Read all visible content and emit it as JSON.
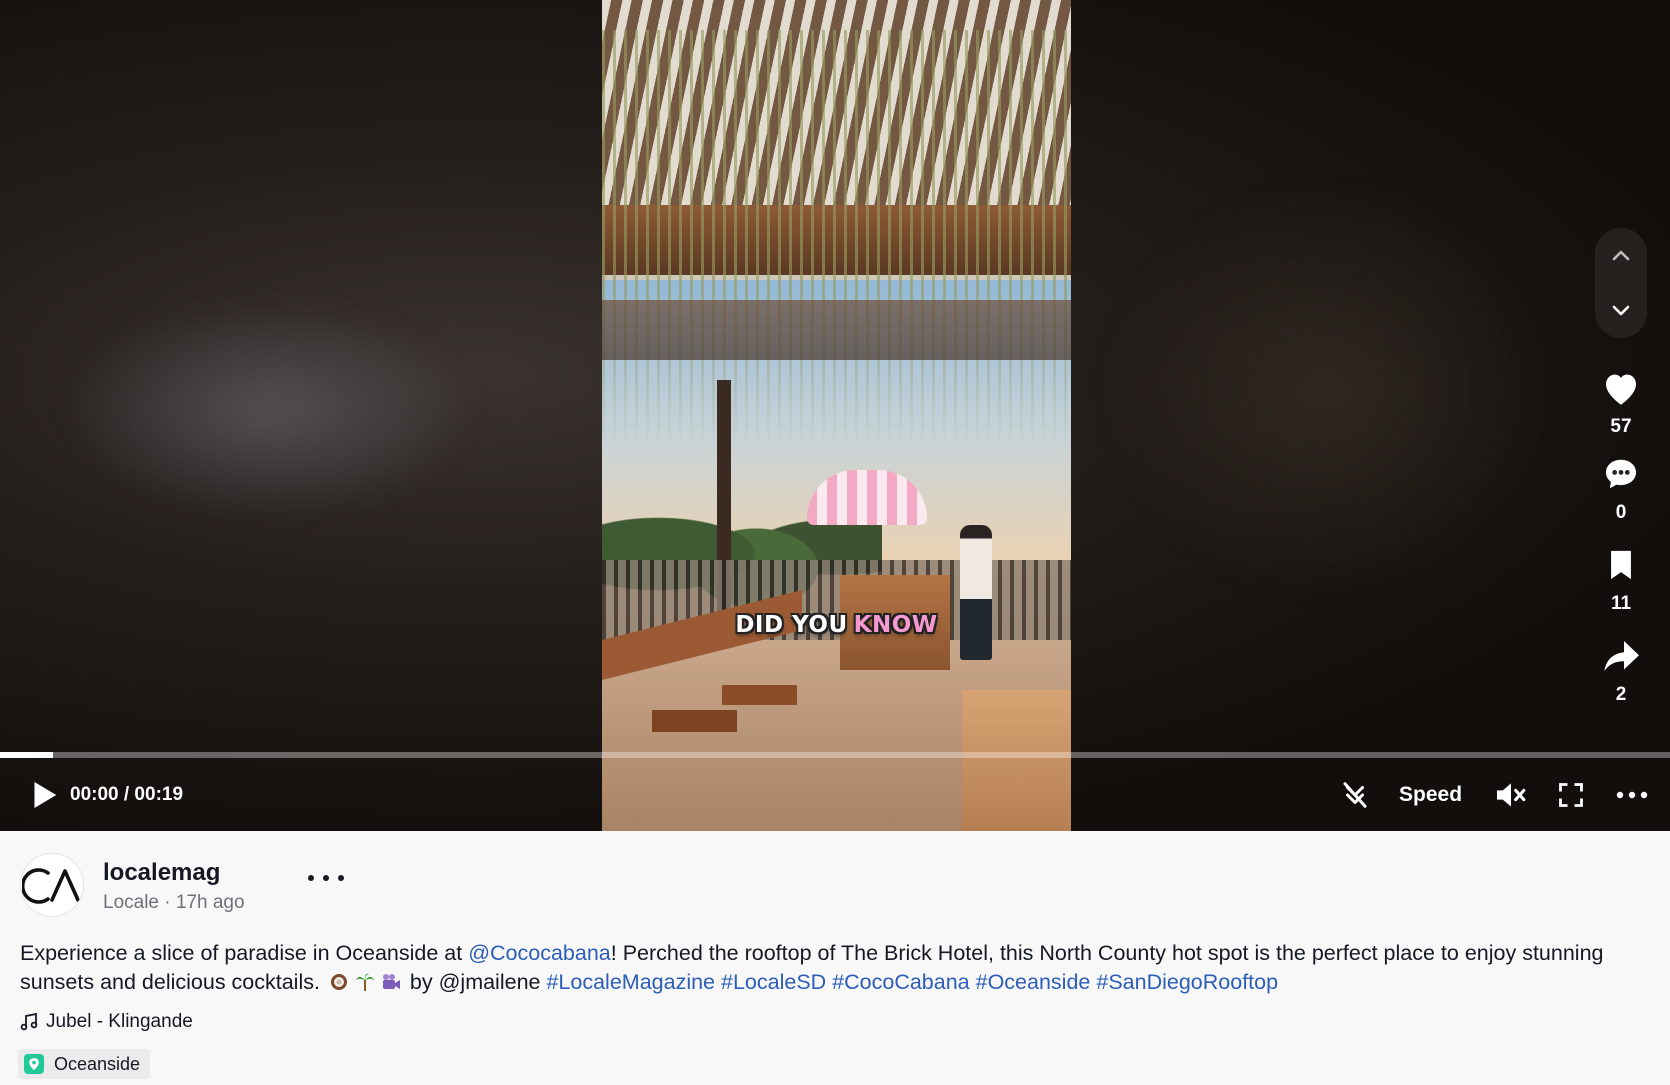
{
  "video": {
    "overlay_caption_part1": "DID YOU",
    "overlay_caption_part2": "KNOW",
    "current_time": "00:00",
    "duration": "00:19",
    "time_display": "00:00 / 00:19",
    "progress_fraction": 0.032
  },
  "actions": {
    "likes": "57",
    "comments": "0",
    "bookmarks": "11",
    "shares": "2"
  },
  "controls": {
    "speed_label": "Speed"
  },
  "post": {
    "username": "localemag",
    "display_name": "Locale",
    "time_ago": "17h ago",
    "subtitle": "Locale · 17h ago",
    "description": {
      "text_1": "Experience a slice of paradise in Oceanside at ",
      "mention": "@Cococabana",
      "text_2": "! Perched the rooftop of The Brick Hotel, this North County hot spot is the perfect place to enjoy stunning sunsets and delicious cocktails. ",
      "text_3": " by @jmailene ",
      "hashtags": [
        "#LocaleMagazine",
        "#LocaleSD",
        "#CocoCabana",
        "#Oceanside",
        "#SanDiegoRooftop"
      ]
    },
    "music": "Jubel - Klingande",
    "location": "Oceanside"
  },
  "colors": {
    "link": "#2b5db9",
    "caption_highlight": "#f49ad0",
    "location_pin": "#20c997"
  }
}
